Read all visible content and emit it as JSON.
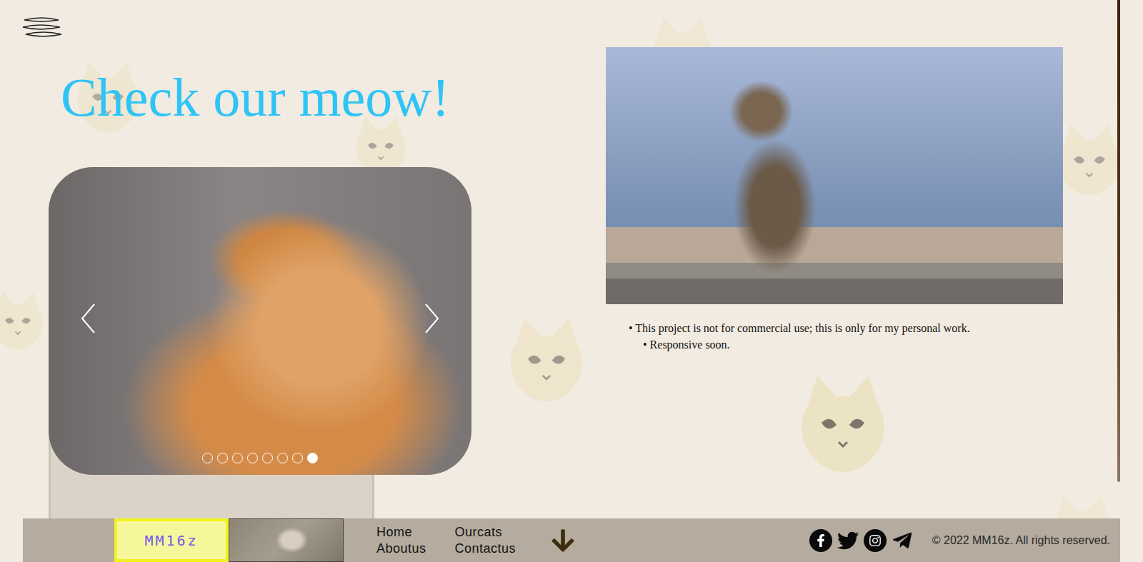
{
  "hero": {
    "title": "Check our meow!"
  },
  "carousel": {
    "slides": [
      {
        "selected": false
      },
      {
        "selected": false
      },
      {
        "selected": false
      },
      {
        "selected": false
      },
      {
        "selected": false
      },
      {
        "selected": false
      },
      {
        "selected": false
      },
      {
        "selected": true
      }
    ]
  },
  "notes": {
    "bullet": "•",
    "items": [
      "This project is not for commercial use; this is only for my personal work.",
      "Responsive soon."
    ]
  },
  "footer": {
    "logo": "MM16z",
    "nav": [
      "Home",
      "Ourcats",
      "Aboutus",
      "Contactus"
    ],
    "social": [
      "facebook",
      "twitter",
      "instagram",
      "telegram"
    ],
    "copyright": "© 2022 MM16z. All rights reserved."
  }
}
